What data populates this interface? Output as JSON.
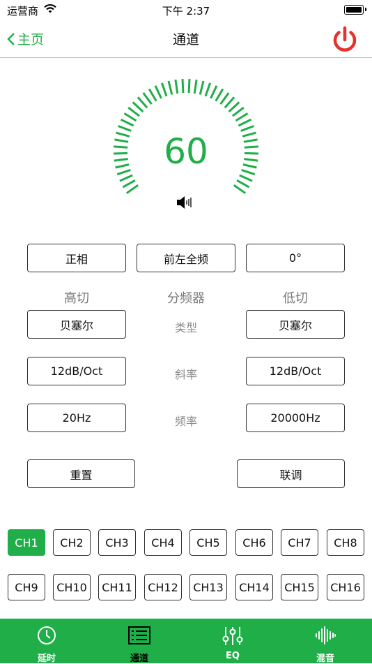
{
  "status_bar": {
    "carrier": "运营商",
    "time": "下午 2:37"
  },
  "nav": {
    "back_label": "主页",
    "title": "通道"
  },
  "dial": {
    "value": "60"
  },
  "row1": {
    "phase": "正相",
    "channel_name": "前左全频",
    "angle": "0°"
  },
  "crossover": {
    "high_cut": "高切",
    "title": "分频器",
    "low_cut": "低切",
    "rows": [
      {
        "label": "类型",
        "high": "贝塞尔",
        "low": "贝塞尔"
      },
      {
        "label": "斜率",
        "high": "12dB/Oct",
        "low": "12dB/Oct"
      },
      {
        "label": "频率",
        "high": "20Hz",
        "low": "20000Hz"
      }
    ]
  },
  "actions": {
    "reset": "重置",
    "link": "联调"
  },
  "channels": [
    "CH1",
    "CH2",
    "CH3",
    "CH4",
    "CH5",
    "CH6",
    "CH7",
    "CH8",
    "CH9",
    "CH10",
    "CH11",
    "CH12",
    "CH13",
    "CH14",
    "CH15",
    "CH16"
  ],
  "active_channel": "CH1",
  "tabs": [
    {
      "label": "延时",
      "icon": "clock-icon"
    },
    {
      "label": "通道",
      "icon": "list-icon"
    },
    {
      "label": "EQ",
      "icon": "sliders-icon"
    },
    {
      "label": "混音",
      "icon": "waveform-icon"
    }
  ],
  "colors": {
    "accent": "#1fae48",
    "power": "#e5322d"
  }
}
